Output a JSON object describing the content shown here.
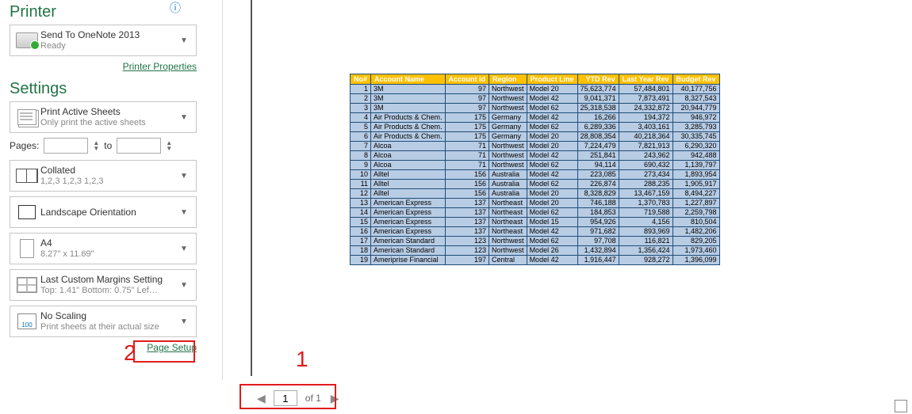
{
  "printer": {
    "heading": "Printer",
    "name": "Send To OneNote 2013",
    "status": "Ready",
    "properties_link": "Printer Properties"
  },
  "settings": {
    "heading": "Settings",
    "sheets": {
      "main": "Print Active Sheets",
      "sub": "Only print the active sheets"
    },
    "pages_label": "Pages:",
    "to_label": "to",
    "collate": {
      "main": "Collated",
      "sub": "1,2,3   1,2,3   1,2,3"
    },
    "orient": {
      "main": "Landscape Orientation"
    },
    "size": {
      "main": "A4",
      "sub": "8.27\" x 11.69\""
    },
    "margins": {
      "main": "Last Custom Margins Setting",
      "sub": "Top: 1.41\" Bottom: 0.75\" Lef…"
    },
    "scale": {
      "main": "No Scaling",
      "sub": "Print sheets at their actual size"
    },
    "page_setup_link": "Page Setup"
  },
  "nav": {
    "current": "1",
    "of": "of 1"
  },
  "annotations": {
    "one": "1",
    "two": "2"
  },
  "table": {
    "headers": [
      "No#",
      "Account Name",
      "Account id",
      "Region",
      "Product Line",
      "YTD Rev",
      "Last Year Rev",
      "Budget Rev"
    ],
    "align": [
      "num",
      "",
      "num",
      "",
      "",
      "num",
      "num",
      "num"
    ],
    "rows": [
      [
        "1",
        "3M",
        "97",
        "Northwest",
        "Model 20",
        "75,623,774",
        "57,484,801",
        "40,177,756"
      ],
      [
        "2",
        "3M",
        "97",
        "Northwest",
        "Model 42",
        "9,041,371",
        "7,873,491",
        "8,327,543"
      ],
      [
        "3",
        "3M",
        "97",
        "Northwest",
        "Model 62",
        "25,318,538",
        "24,332,872",
        "20,944,779"
      ],
      [
        "4",
        "Air Products & Chem.",
        "175",
        "Germany",
        "Model 42",
        "16,266",
        "194,372",
        "946,972"
      ],
      [
        "5",
        "Air Products & Chem.",
        "175",
        "Germany",
        "Model 62",
        "6,289,336",
        "3,403,161",
        "3,285,793"
      ],
      [
        "6",
        "Air Products & Chem.",
        "175",
        "Germany",
        "Model 20",
        "28,808,354",
        "40,218,364",
        "30,335,745"
      ],
      [
        "7",
        "Alcoa",
        "71",
        "Northwest",
        "Model 20",
        "7,224,479",
        "7,821,913",
        "6,290,320"
      ],
      [
        "8",
        "Alcoa",
        "71",
        "Northwest",
        "Model 42",
        "251,841",
        "243,962",
        "942,488"
      ],
      [
        "9",
        "Alcoa",
        "71",
        "Northwest",
        "Model 62",
        "94,114",
        "690,432",
        "1,139,797"
      ],
      [
        "10",
        "Alltel",
        "156",
        "Australia",
        "Model 42",
        "223,085",
        "273,434",
        "1,893,954"
      ],
      [
        "11",
        "Alltel",
        "156",
        "Australia",
        "Model 62",
        "226,874",
        "288,235",
        "1,905,917"
      ],
      [
        "12",
        "Alltel",
        "156",
        "Australia",
        "Model 20",
        "8,328,829",
        "13,467,159",
        "8,494,227"
      ],
      [
        "13",
        "American Express",
        "137",
        "Northeast",
        "Model 20",
        "746,188",
        "1,370,783",
        "1,227,897"
      ],
      [
        "14",
        "American Express",
        "137",
        "Northeast",
        "Model 62",
        "184,853",
        "719,588",
        "2,259,798"
      ],
      [
        "15",
        "American Express",
        "137",
        "Northeast",
        "Model 15",
        "954,926",
        "4,156",
        "810,504"
      ],
      [
        "16",
        "American Express",
        "137",
        "Northeast",
        "Model 42",
        "971,682",
        "893,969",
        "1,482,206"
      ],
      [
        "17",
        "American Standard",
        "123",
        "Northwest",
        "Model 62",
        "97,708",
        "116,821",
        "829,205"
      ],
      [
        "18",
        "American Standard",
        "123",
        "Northwest",
        "Model 26",
        "1,432,894",
        "1,356,424",
        "1,973,460"
      ],
      [
        "19",
        "Ameriprise Financial",
        "197",
        "Central",
        "Model 42",
        "1,916,447",
        "928,272",
        "1,396,099"
      ]
    ]
  }
}
